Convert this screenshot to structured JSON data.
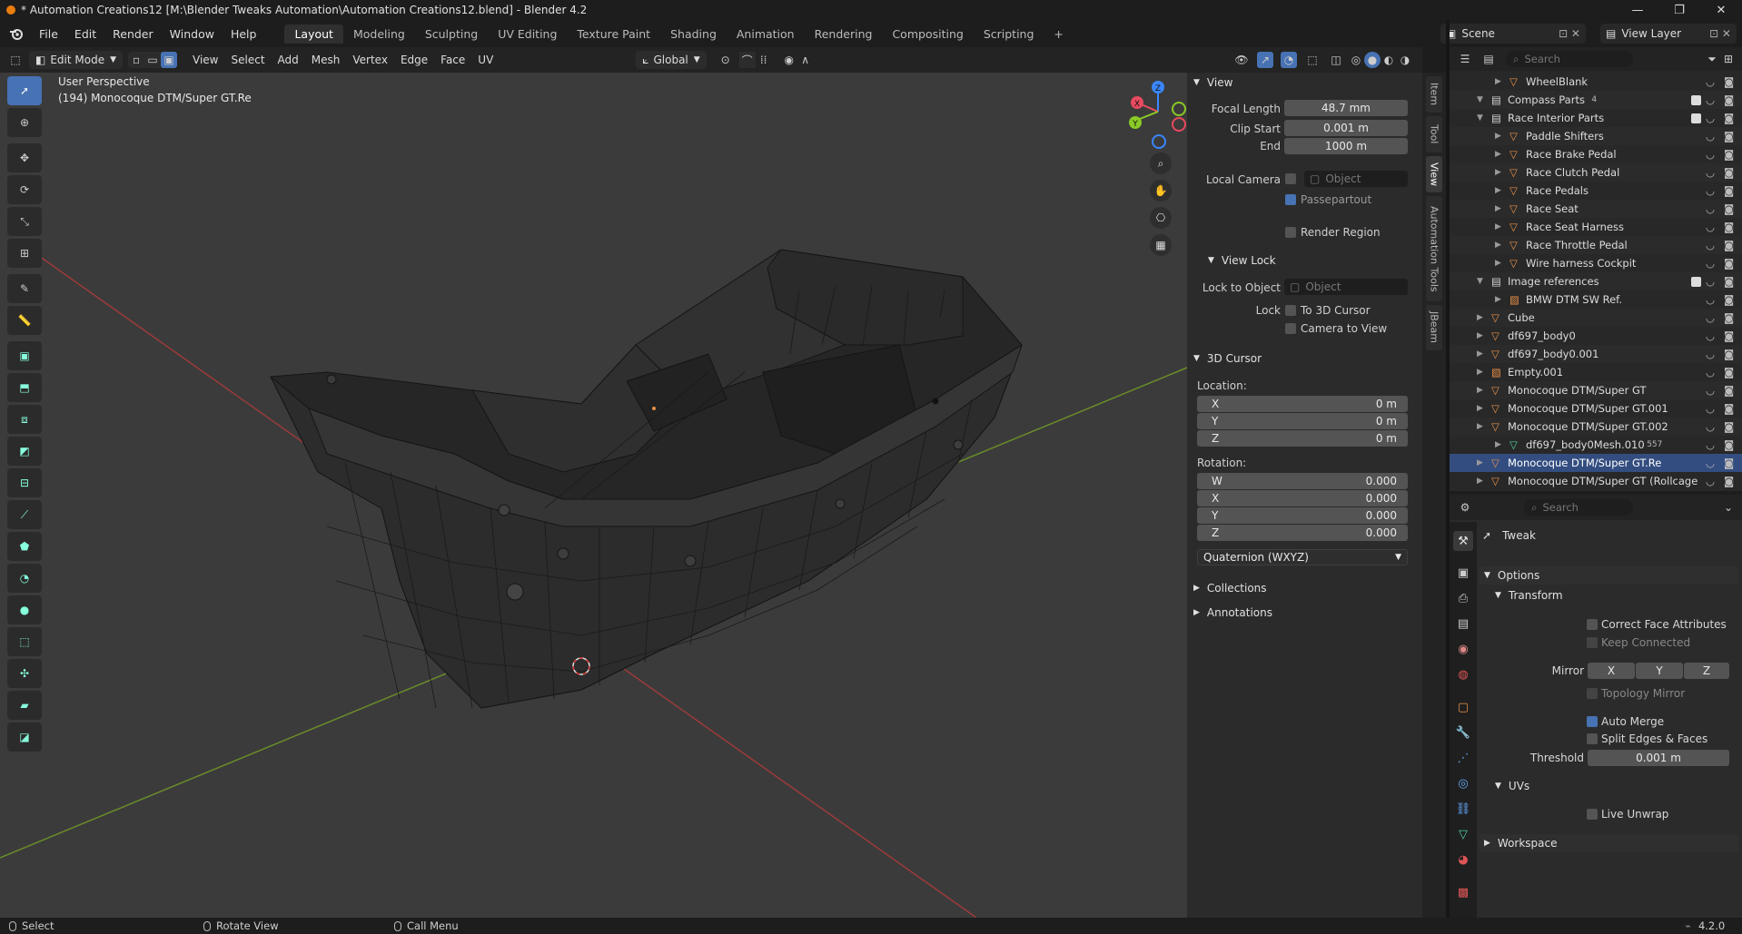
{
  "window": {
    "title": "* Automation Creations12 [M:\\Blender Tweaks Automation\\Automation Creations12.blend] - Blender 4.2",
    "controls": [
      "—",
      "❐",
      "✕"
    ]
  },
  "menu": {
    "items": [
      "File",
      "Edit",
      "Render",
      "Window",
      "Help"
    ],
    "workspaces": [
      "Layout",
      "Modeling",
      "Sculpting",
      "UV Editing",
      "Texture Paint",
      "Shading",
      "Animation",
      "Rendering",
      "Compositing",
      "Scripting"
    ],
    "active_workspace": "Layout",
    "add_tab": "+",
    "scene": "Scene",
    "view_layer": "View Layer"
  },
  "viewport_header": {
    "mode": "Edit Mode",
    "menus": [
      "View",
      "Select",
      "Add",
      "Mesh",
      "Vertex",
      "Edge",
      "Face",
      "UV"
    ],
    "orientation": "Global"
  },
  "viewport": {
    "perspective": "User Perspective",
    "object_info": "(194) Monocoque DTM/Super GT.Re",
    "gizmo_labels": {
      "x": "X",
      "y": "Y",
      "z": "Z"
    }
  },
  "npanel": {
    "tabs": [
      "Item",
      "Tool",
      "View",
      "Automation Tools",
      "JBeam"
    ],
    "active_tab": "View",
    "view": {
      "header": "View",
      "focal_length_label": "Focal Length",
      "focal_length": "48.7 mm",
      "clip_start_label": "Clip Start",
      "clip_start": "0.001 m",
      "end_label": "End",
      "end": "1000 m",
      "local_camera_label": "Local Camera",
      "local_camera_placeholder": "Object",
      "passepartout": "Passepartout",
      "render_region": "Render Region"
    },
    "view_lock": {
      "header": "View Lock",
      "lock_to_object_label": "Lock to Object",
      "lock_object_placeholder": "Object",
      "lock_label": "Lock",
      "to_3d_cursor": "To 3D Cursor",
      "camera_to_view": "Camera to View"
    },
    "cursor": {
      "header": "3D Cursor",
      "location_label": "Location:",
      "location": [
        {
          "axis": "X",
          "value": "0 m"
        },
        {
          "axis": "Y",
          "value": "0 m"
        },
        {
          "axis": "Z",
          "value": "0 m"
        }
      ],
      "rotation_label": "Rotation:",
      "rotation": [
        {
          "axis": "W",
          "value": "0.000"
        },
        {
          "axis": "X",
          "value": "0.000"
        },
        {
          "axis": "Y",
          "value": "0.000"
        },
        {
          "axis": "Z",
          "value": "0.000"
        }
      ],
      "rotation_mode": "Quaternion (WXYZ)"
    },
    "collections": "Collections",
    "annotations": "Annotations"
  },
  "outliner": {
    "search_placeholder": "Search",
    "rows": [
      {
        "name": "WheelBlank",
        "indent": 2,
        "type": "object",
        "badge": "",
        "checkbox": false
      },
      {
        "name": "Compass Parts",
        "indent": 1,
        "type": "collection",
        "badge": "4",
        "checkbox": true
      },
      {
        "name": "Race Interior Parts",
        "indent": 1,
        "type": "collection",
        "badge": "",
        "checkbox": true
      },
      {
        "name": "Paddle Shifters",
        "indent": 2,
        "type": "object",
        "badge": "",
        "checkbox": false
      },
      {
        "name": "Race Brake Pedal",
        "indent": 2,
        "type": "object",
        "badge": "",
        "checkbox": false
      },
      {
        "name": "Race Clutch Pedal",
        "indent": 2,
        "type": "object",
        "badge": "",
        "checkbox": false
      },
      {
        "name": "Race Pedals",
        "indent": 2,
        "type": "object",
        "badge": "",
        "checkbox": false
      },
      {
        "name": "Race Seat",
        "indent": 2,
        "type": "object",
        "badge": "",
        "checkbox": false
      },
      {
        "name": "Race Seat Harness",
        "indent": 2,
        "type": "object",
        "badge": "",
        "checkbox": false
      },
      {
        "name": "Race Throttle Pedal",
        "indent": 2,
        "type": "object",
        "badge": "",
        "checkbox": false
      },
      {
        "name": "Wire harness Cockpit",
        "indent": 2,
        "type": "object",
        "badge": "",
        "checkbox": false
      },
      {
        "name": "Image references",
        "indent": 1,
        "type": "collection",
        "badge": "",
        "checkbox": true
      },
      {
        "name": "BMW DTM SW Ref.",
        "indent": 2,
        "type": "image",
        "badge": "",
        "checkbox": false
      },
      {
        "name": "Cube",
        "indent": 1,
        "type": "object",
        "badge": "",
        "checkbox": false
      },
      {
        "name": "df697_body0",
        "indent": 1,
        "type": "object",
        "badge": "",
        "checkbox": false
      },
      {
        "name": "df697_body0.001",
        "indent": 1,
        "type": "object",
        "badge": "",
        "checkbox": false
      },
      {
        "name": "Empty.001",
        "indent": 1,
        "type": "image",
        "badge": "",
        "checkbox": false
      },
      {
        "name": "Monocoque DTM/Super GT",
        "indent": 1,
        "type": "object",
        "badge": "",
        "checkbox": false
      },
      {
        "name": "Monocoque DTM/Super GT.001",
        "indent": 1,
        "type": "object",
        "badge": "",
        "checkbox": false
      },
      {
        "name": "Monocoque DTM/Super GT.002",
        "indent": 1,
        "type": "object",
        "badge": "",
        "checkbox": false
      },
      {
        "name": "df697_body0Mesh.010",
        "indent": 2,
        "type": "mesh",
        "badge": "557",
        "checkbox": false
      },
      {
        "name": "Monocoque DTM/Super GT.Re",
        "indent": 1,
        "type": "object",
        "badge": "",
        "checkbox": false,
        "selected": true
      },
      {
        "name": "Monocoque DTM/Super GT (Rollcage",
        "indent": 1,
        "type": "object",
        "badge": "",
        "checkbox": false
      }
    ]
  },
  "properties": {
    "search_placeholder": "Search",
    "tool_name": "Tweak",
    "options_header": "Options",
    "transform_header": "Transform",
    "correct_face_attributes": "Correct Face Attributes",
    "keep_connected": "Keep Connected",
    "mirror_label": "Mirror",
    "mirror_axes": [
      "X",
      "Y",
      "Z"
    ],
    "topology_mirror": "Topology Mirror",
    "auto_merge": "Auto Merge",
    "split_edges_faces": "Split Edges & Faces",
    "threshold_label": "Threshold",
    "threshold": "0.001 m",
    "uvs_header": "UVs",
    "live_unwrap": "Live Unwrap",
    "workspace_header": "Workspace"
  },
  "status_bar": {
    "select": "Select",
    "rotate_view": "Rotate View",
    "call_menu": "Call Menu",
    "version": "4.2.0"
  },
  "colors": {
    "accent": "#4772b3",
    "selected_row": "#334d80",
    "axis_x": "#e84a5f",
    "axis_y": "#8ac926",
    "axis_z": "#3a86ff",
    "object_icon": "#e8914a",
    "mesh_icon": "#4ed19a"
  }
}
